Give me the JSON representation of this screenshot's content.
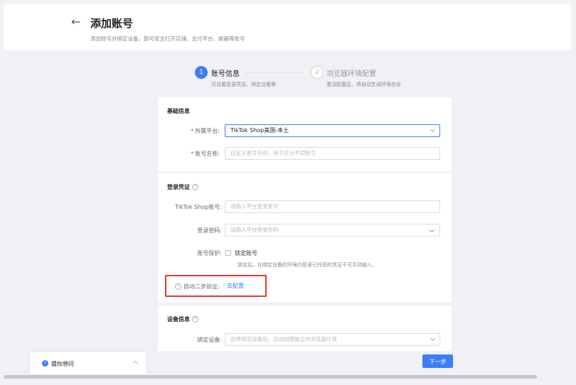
{
  "header": {
    "title": "添加账号",
    "subtitle": "添加账号并绑定设备，即可安全打开店铺、支付平台、邮箱等账号"
  },
  "steps": [
    {
      "number": "1",
      "title": "账号信息",
      "desc": "可设置登录凭证、绑定设备等",
      "state": "active"
    },
    {
      "number": "2",
      "title": "浏览器环境配置",
      "desc": "激活配置后，将自动生成环境信息",
      "state": "inactive"
    }
  ],
  "basic_info": {
    "title": "基础信息",
    "platform_label": "所属平台:",
    "platform_value": "TikTok Shop美国-本土",
    "account_name_label": "账号名称:",
    "account_name_placeholder": "自定义账号名称，用于区分不同账号"
  },
  "credentials": {
    "title": "登录凭证",
    "tiktok_account_label": "TikTok Shop账号:",
    "tiktok_account_placeholder": "请输入平台登录账号",
    "password_label": "登录密码:",
    "password_placeholder": "请输入平台登录密码",
    "protection_label": "账号保护:",
    "lock_account_label": "锁定账号",
    "lock_note": "锁定后，在绑定设备的环境内登录已托管的凭证不可手动输入。",
    "two_step_label": "自动二步验证:",
    "config_link": "去配置"
  },
  "device_info": {
    "title": "设备信息",
    "bind_device_label": "绑定设备:",
    "bind_device_placeholder": "选择绑定设备后，自动创建独立的浏览器环境"
  },
  "actions": {
    "next_label": "下一步"
  },
  "help_widget": {
    "label": "猜你想问"
  },
  "colors": {
    "accent": "#3d7dfa",
    "required": "#e53935",
    "highlight_border": "#e53935"
  }
}
